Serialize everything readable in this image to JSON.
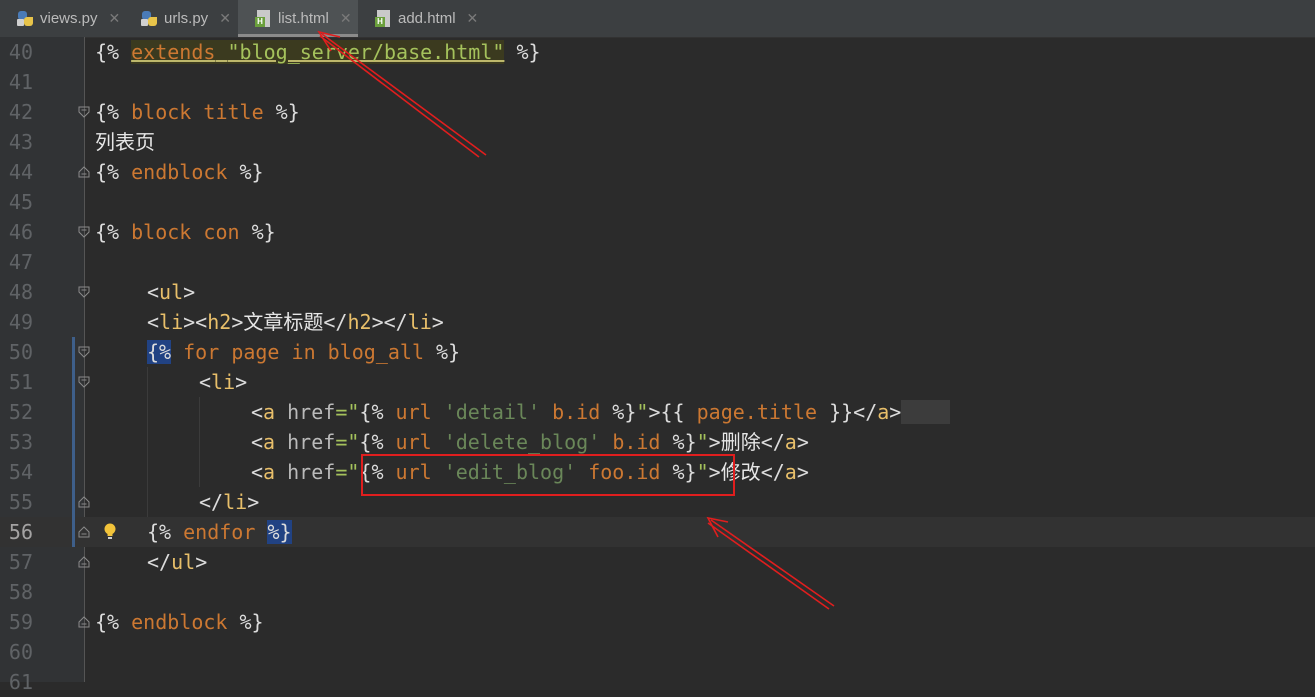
{
  "tabs": [
    {
      "label": "views.py",
      "icon": "python-file-icon",
      "active": false
    },
    {
      "label": "urls.py",
      "icon": "python-file-icon",
      "active": false
    },
    {
      "label": "list.html",
      "icon": "html-file-icon",
      "active": true
    },
    {
      "label": "add.html",
      "icon": "html-file-icon",
      "active": false
    }
  ],
  "close_glyph": "✕",
  "lines": [
    {
      "num": "40",
      "tokens": [
        [
          "{%",
          "plain"
        ],
        [
          " ",
          "plain"
        ],
        [
          "extends",
          "kwerr"
        ],
        [
          " ",
          "err"
        ],
        [
          "\"blog_server/base.html\"",
          "strerr"
        ],
        [
          " %}",
          "plain"
        ]
      ]
    },
    {
      "num": "41",
      "tokens": []
    },
    {
      "num": "42",
      "tokens": [
        [
          "{%",
          "plain"
        ],
        [
          " ",
          "plain"
        ],
        [
          "block",
          "kw"
        ],
        [
          " ",
          "plain"
        ],
        [
          "title",
          "kw"
        ],
        [
          " %}",
          "plain"
        ]
      ]
    },
    {
      "num": "43",
      "tokens": [
        [
          "列表页",
          "cn"
        ]
      ]
    },
    {
      "num": "44",
      "tokens": [
        [
          "{%",
          "plain"
        ],
        [
          " ",
          "plain"
        ],
        [
          "endblock",
          "kw"
        ],
        [
          " %}",
          "plain"
        ]
      ]
    },
    {
      "num": "45",
      "tokens": []
    },
    {
      "num": "46",
      "tokens": [
        [
          "{%",
          "plain"
        ],
        [
          " ",
          "plain"
        ],
        [
          "block",
          "kw"
        ],
        [
          " ",
          "plain"
        ],
        [
          "con",
          "kw"
        ],
        [
          " %}",
          "plain"
        ]
      ]
    },
    {
      "num": "47",
      "tokens": []
    },
    {
      "num": "48",
      "tokens": [
        [
          "<",
          "plain"
        ],
        [
          "ul",
          "tag"
        ],
        [
          ">",
          "plain"
        ]
      ]
    },
    {
      "num": "49",
      "tokens": [
        [
          "<",
          "plain"
        ],
        [
          "li",
          "tag"
        ],
        [
          "><",
          "plain"
        ],
        [
          "h2",
          "tag"
        ],
        [
          ">",
          "plain"
        ],
        [
          "文章标题",
          "cn"
        ],
        [
          "</",
          "plain"
        ],
        [
          "h2",
          "tag"
        ],
        [
          "></",
          "plain"
        ],
        [
          "li",
          "tag"
        ],
        [
          ">",
          "plain"
        ]
      ]
    },
    {
      "num": "50",
      "tokens": [
        [
          "{%",
          "match"
        ],
        [
          " ",
          "plain"
        ],
        [
          "for",
          "kw"
        ],
        [
          " ",
          "plain"
        ],
        [
          "page",
          "kw"
        ],
        [
          " ",
          "plain"
        ],
        [
          "in",
          "kw"
        ],
        [
          " ",
          "plain"
        ],
        [
          "blog_all",
          "kw"
        ],
        [
          " %}",
          "plain"
        ]
      ]
    },
    {
      "num": "51",
      "tokens": [
        [
          "<",
          "plain"
        ],
        [
          "li",
          "tag"
        ],
        [
          ">",
          "plain"
        ]
      ]
    },
    {
      "num": "52",
      "tokens": [
        [
          "<",
          "plain"
        ],
        [
          "a",
          "tag"
        ],
        [
          " ",
          "plain"
        ],
        [
          "href",
          "attr"
        ],
        [
          "=\"",
          "str"
        ],
        [
          "{%",
          "plain"
        ],
        [
          " ",
          "plain"
        ],
        [
          "url",
          "kw"
        ],
        [
          " ",
          "plain"
        ],
        [
          "'detail'",
          "str2"
        ],
        [
          " ",
          "plain"
        ],
        [
          "b.id",
          "kw"
        ],
        [
          " %}",
          "plain"
        ],
        [
          "\"",
          "str"
        ],
        [
          ">{{ ",
          "plain"
        ],
        [
          "page.title",
          "kw"
        ],
        [
          " }}</",
          "plain"
        ],
        [
          "a",
          "tag"
        ],
        [
          ">",
          "plain"
        ],
        [
          "    ",
          "flag"
        ]
      ]
    },
    {
      "num": "53",
      "tokens": [
        [
          "<",
          "plain"
        ],
        [
          "a",
          "tag"
        ],
        [
          " ",
          "plain"
        ],
        [
          "href",
          "attr"
        ],
        [
          "=\"",
          "str"
        ],
        [
          "{%",
          "plain"
        ],
        [
          " ",
          "plain"
        ],
        [
          "url",
          "kw"
        ],
        [
          " ",
          "plain"
        ],
        [
          "'delete_blog'",
          "str2"
        ],
        [
          " ",
          "plain"
        ],
        [
          "b.id",
          "kw"
        ],
        [
          " %}",
          "plain"
        ],
        [
          "\"",
          "str"
        ],
        [
          ">",
          "plain"
        ],
        [
          "删除",
          "cn"
        ],
        [
          "</",
          "plain"
        ],
        [
          "a",
          "tag"
        ],
        [
          ">",
          "plain"
        ]
      ]
    },
    {
      "num": "54",
      "tokens": [
        [
          "<",
          "plain"
        ],
        [
          "a",
          "tag"
        ],
        [
          " ",
          "plain"
        ],
        [
          "href",
          "attr"
        ],
        [
          "=\"",
          "str"
        ],
        [
          "{%",
          "plain"
        ],
        [
          " ",
          "plain"
        ],
        [
          "url",
          "kw"
        ],
        [
          " ",
          "plain"
        ],
        [
          "'edit_blog'",
          "str2"
        ],
        [
          " ",
          "plain"
        ],
        [
          "foo.id",
          "kw"
        ],
        [
          " %}",
          "plain"
        ],
        [
          "\"",
          "str"
        ],
        [
          ">",
          "plain"
        ],
        [
          "修改",
          "cn"
        ],
        [
          "</",
          "plain"
        ],
        [
          "a",
          "tag"
        ],
        [
          ">",
          "plain"
        ]
      ]
    },
    {
      "num": "55",
      "tokens": [
        [
          "</",
          "plain"
        ],
        [
          "li",
          "tag"
        ],
        [
          ">",
          "plain"
        ]
      ]
    },
    {
      "num": "56",
      "tokens": [
        [
          "{%",
          "plain"
        ],
        [
          " ",
          "plain"
        ],
        [
          "endfor",
          "kw"
        ],
        [
          " ",
          "plain"
        ],
        [
          "%}",
          "match"
        ]
      ]
    },
    {
      "num": "57",
      "tokens": [
        [
          "</",
          "plain"
        ],
        [
          "ul",
          "tag"
        ],
        [
          ">",
          "plain"
        ]
      ]
    },
    {
      "num": "58",
      "tokens": []
    },
    {
      "num": "59",
      "tokens": [
        [
          "{%",
          "plain"
        ],
        [
          " ",
          "plain"
        ],
        [
          "endblock",
          "kw"
        ],
        [
          " %}",
          "plain"
        ]
      ]
    },
    {
      "num": "60",
      "tokens": []
    },
    {
      "num": "61",
      "tokens": []
    }
  ],
  "colors": {
    "annotation": "#e01e1e",
    "editor_bg": "#2b2b2b",
    "tab_bar_bg": "#3c3f41"
  }
}
